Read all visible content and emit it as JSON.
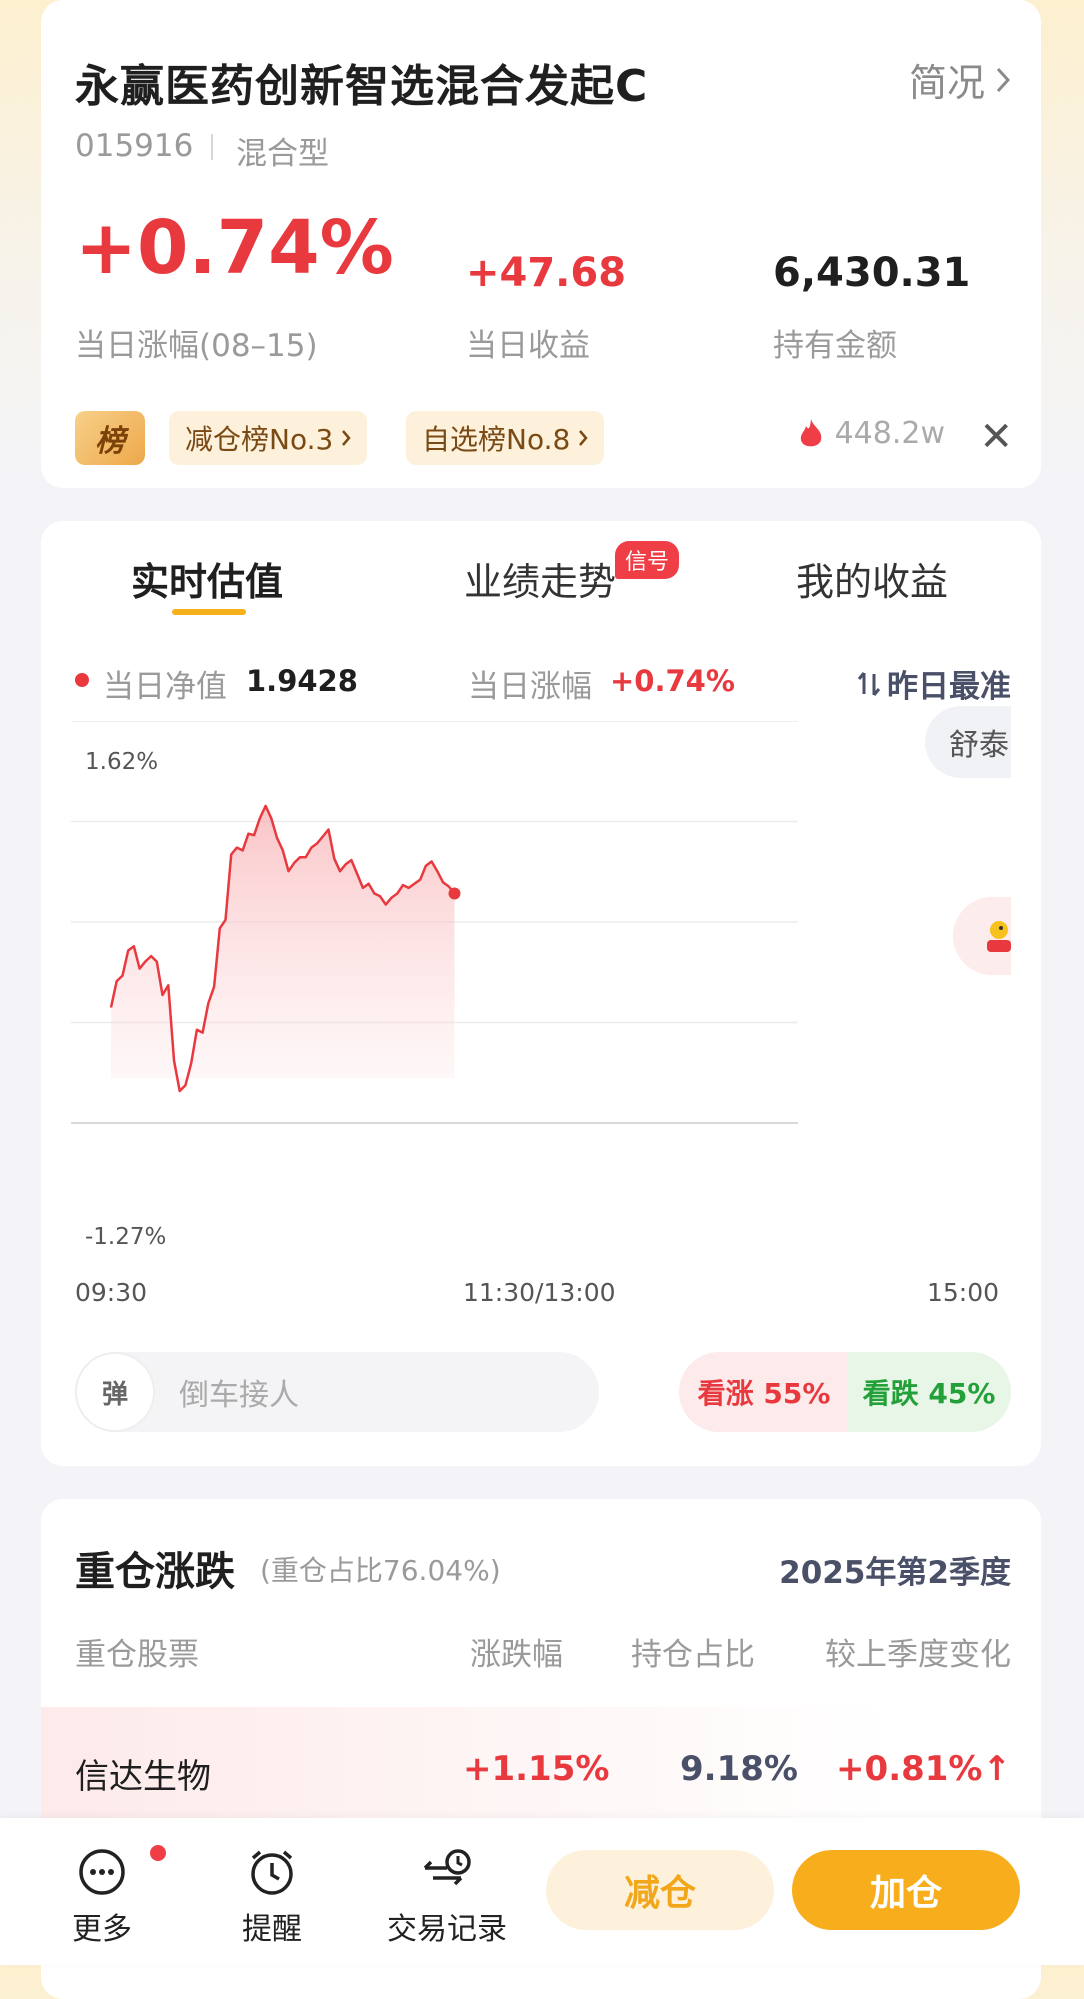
{
  "fund": {
    "name": "永赢医药创新智选混合发起C",
    "overview_label": "简况",
    "code": "015916",
    "type": "混合型",
    "day_change": "+0.74%",
    "day_change_label": "当日涨幅(08–15)",
    "day_profit": "+47.68",
    "day_profit_label": "当日收益",
    "holding_amount": "6,430.31",
    "holding_amount_label": "持有金额",
    "rank_icon_text": "榜",
    "chips": [
      "减仓榜No.3",
      "自选榜No.8"
    ],
    "hot_count": "448.2w"
  },
  "tabs": {
    "realtime": "实时估值",
    "performance": "业绩走势",
    "performance_badge": "信号",
    "my_profit": "我的收益"
  },
  "estimate": {
    "nav_label": "当日净值",
    "nav_value": "1.9428",
    "change_label": "当日涨幅",
    "change_value": "+0.74%",
    "accuracy_label": "昨日最准",
    "side_pill": "舒泰"
  },
  "chart_data": {
    "type": "area",
    "y_max_label": "1.62%",
    "y_min_label": "-1.27%",
    "ylim": [
      -1.27,
      1.62
    ],
    "x_labels": [
      "09:30",
      "11:30/13:00",
      "15:00"
    ],
    "x": [
      0,
      2,
      4,
      6,
      8,
      10,
      12,
      14,
      16,
      18,
      20,
      22,
      24,
      26,
      28,
      30,
      32,
      34,
      36,
      38,
      40,
      42,
      44,
      46,
      48,
      50,
      52,
      54,
      56,
      58,
      60,
      62,
      64,
      66,
      68,
      70,
      72,
      74,
      76,
      78,
      80,
      82,
      84,
      86,
      88,
      90,
      92,
      94,
      96,
      98,
      100,
      102,
      104,
      106,
      108,
      110,
      112,
      114,
      116,
      118,
      120
    ],
    "values": [
      -0.44,
      -0.25,
      -0.21,
      -0.03,
      0.0,
      -0.16,
      -0.11,
      -0.07,
      -0.11,
      -0.35,
      -0.28,
      -0.82,
      -1.04,
      -1.0,
      -0.84,
      -0.6,
      -0.62,
      -0.41,
      -0.29,
      0.13,
      0.19,
      0.66,
      0.71,
      0.69,
      0.81,
      0.8,
      0.92,
      1.01,
      0.92,
      0.78,
      0.69,
      0.54,
      0.6,
      0.64,
      0.64,
      0.71,
      0.74,
      0.79,
      0.84,
      0.63,
      0.54,
      0.59,
      0.62,
      0.52,
      0.42,
      0.45,
      0.38,
      0.36,
      0.3,
      0.35,
      0.38,
      0.44,
      0.42,
      0.45,
      0.48,
      0.58,
      0.61,
      0.54,
      0.46,
      0.43,
      0.38
    ],
    "colors": {
      "line": "#e8393f",
      "fill_top": "#fbc9cb"
    }
  },
  "interaction": {
    "danmu_icon": "弹",
    "danmu_placeholder": "倒车接人",
    "vote_up": "看涨 55%",
    "vote_down": "看跌 45%"
  },
  "holdings": {
    "title": "重仓涨跌",
    "subtitle": "(重仓占比76.04%)",
    "quarter": "2025年第2季度",
    "headers": [
      "重仓股票",
      "涨跌幅",
      "持仓占比",
      "较上季度变化"
    ],
    "rows": [
      {
        "name": "信达生物",
        "change": "+1.15%",
        "weight": "9.18%",
        "delta": "+0.81%"
      }
    ]
  },
  "bottom_bar": {
    "more": "更多",
    "remind": "提醒",
    "records": "交易记录",
    "reduce": "减仓",
    "add": "加仓"
  }
}
